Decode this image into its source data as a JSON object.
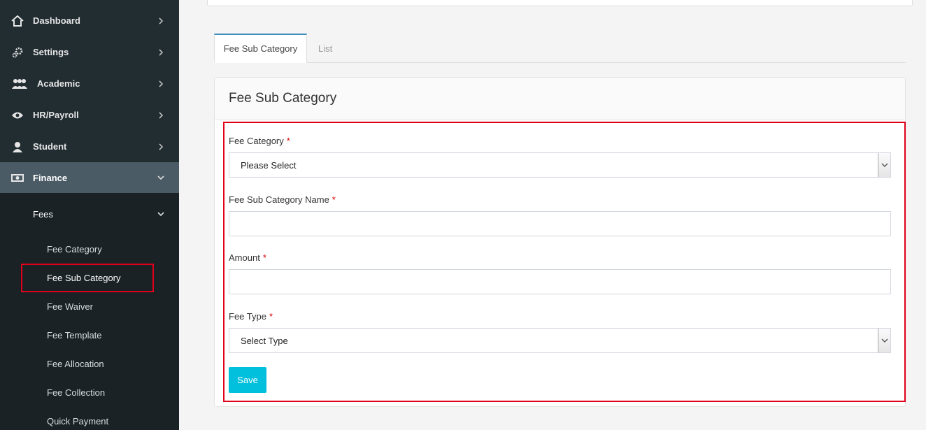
{
  "sidebar": {
    "items": [
      {
        "label": "Dashboard",
        "icon": "home-icon"
      },
      {
        "label": "Settings",
        "icon": "gears-icon"
      },
      {
        "label": "Academic",
        "icon": "users-icon"
      },
      {
        "label": "HR/Payroll",
        "icon": "eye-icon"
      },
      {
        "label": "Student",
        "icon": "user-icon"
      },
      {
        "label": "Finance",
        "icon": "money-icon"
      }
    ],
    "fees_label": "Fees",
    "sub_items": [
      "Fee Category",
      "Fee Sub Category",
      "Fee Waiver",
      "Fee Template",
      "Fee Allocation",
      "Fee Collection",
      "Quick Payment"
    ]
  },
  "tabs": {
    "active": "Fee Sub Category",
    "list": "List"
  },
  "card": {
    "title": "Fee Sub Category"
  },
  "form": {
    "fee_category_label": "Fee Category",
    "fee_category_value": "Please Select",
    "sub_category_name_label": "Fee Sub Category Name",
    "sub_category_name_value": "",
    "amount_label": "Amount",
    "amount_value": "",
    "fee_type_label": "Fee Type",
    "fee_type_value": "Select Type",
    "required_mark": "*",
    "save_label": "Save"
  },
  "colors": {
    "sidebar_bg": "#222d32",
    "active_bg": "#4b5b66",
    "highlight": "#e0001a",
    "save_button": "#00c0dd"
  }
}
